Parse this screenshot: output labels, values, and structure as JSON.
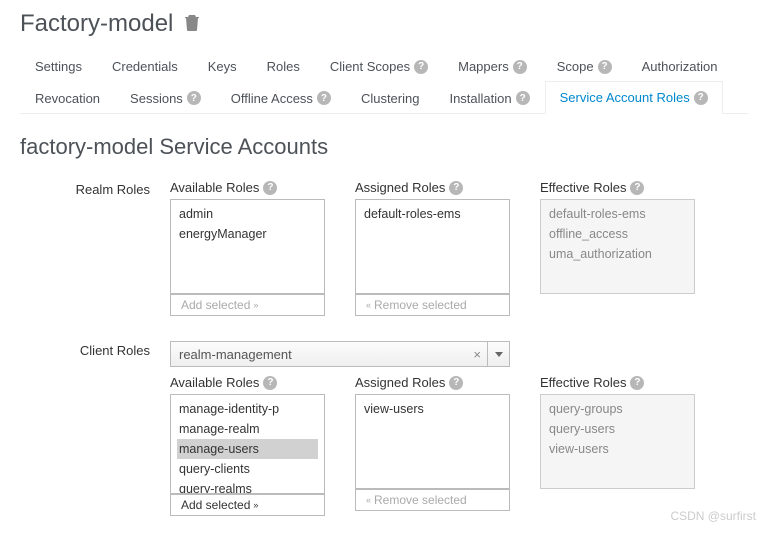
{
  "title": "Factory-model",
  "tabs": {
    "row": [
      {
        "label": "Settings",
        "help": false
      },
      {
        "label": "Credentials",
        "help": false
      },
      {
        "label": "Keys",
        "help": false
      },
      {
        "label": "Roles",
        "help": false
      },
      {
        "label": "Client Scopes",
        "help": true
      },
      {
        "label": "Mappers",
        "help": true
      },
      {
        "label": "Scope",
        "help": true
      },
      {
        "label": "Authorization",
        "help": false
      },
      {
        "label": "Revocation",
        "help": false
      },
      {
        "label": "Sessions",
        "help": true
      },
      {
        "label": "Offline Access",
        "help": true
      },
      {
        "label": "Clustering",
        "help": false
      },
      {
        "label": "Installation",
        "help": true
      },
      {
        "label": "Service Account Roles",
        "help": true,
        "active": true
      }
    ]
  },
  "section_title": "factory-model Service Accounts",
  "realm": {
    "label": "Realm Roles",
    "available_label": "Available Roles",
    "assigned_label": "Assigned Roles",
    "effective_label": "Effective Roles",
    "available": [
      "admin",
      "energyManager"
    ],
    "assigned": [
      "default-roles-ems"
    ],
    "effective": [
      "default-roles-ems",
      "offline_access",
      "uma_authorization"
    ],
    "add_btn": "Add selected",
    "remove_btn": "Remove selected"
  },
  "client": {
    "label": "Client Roles",
    "selected_client": "realm-management",
    "available_label": "Available Roles",
    "assigned_label": "Assigned Roles",
    "effective_label": "Effective Roles",
    "available": [
      "manage-identity-p",
      "manage-realm",
      "manage-users",
      "query-clients",
      "query-realms"
    ],
    "available_selected_index": 2,
    "assigned": [
      "view-users"
    ],
    "effective": [
      "query-groups",
      "query-users",
      "view-users"
    ],
    "add_btn": "Add selected",
    "remove_btn": "Remove selected"
  },
  "watermark": "CSDN @surfirst"
}
